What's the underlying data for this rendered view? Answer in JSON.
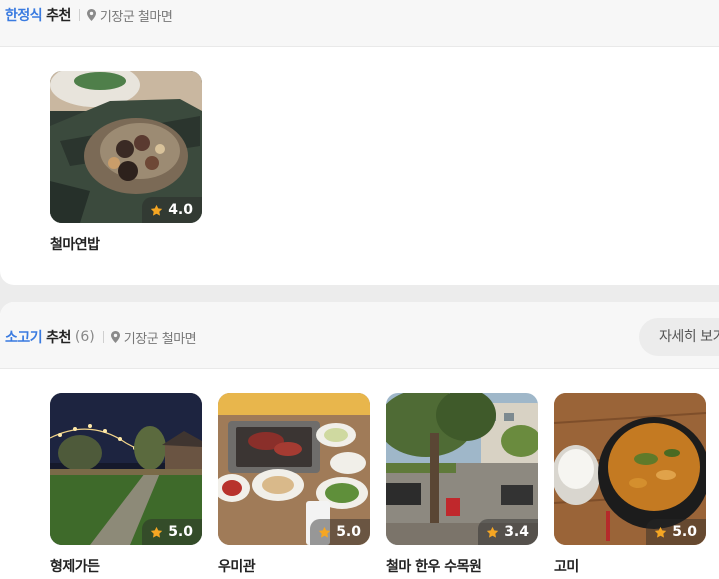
{
  "section1": {
    "category": "한정식",
    "recommend_label": "추천",
    "location": "기장군 철마면",
    "restaurants": [
      {
        "name": "철마연밥",
        "rating": "4.0",
        "photo_icon": "lotus-rice-dish"
      }
    ]
  },
  "section2": {
    "category": "소고기",
    "recommend_label": "추천",
    "count": "(6)",
    "location": "기장군 철마면",
    "more_button": "자세히 보기",
    "restaurants": [
      {
        "name": "형제가든",
        "rating": "5.0",
        "photo_icon": "night-garden-lights"
      },
      {
        "name": "우미관",
        "rating": "5.0",
        "photo_icon": "korean-bbq-table"
      },
      {
        "name": "철마 한우 수목원",
        "rating": "3.4",
        "photo_icon": "outdoor-tree-patio"
      },
      {
        "name": "고미",
        "rating": "5.0",
        "photo_icon": "stew-pot-rice"
      }
    ]
  },
  "colors": {
    "category_accent": "#3a7be0",
    "star": "#f5a623"
  }
}
